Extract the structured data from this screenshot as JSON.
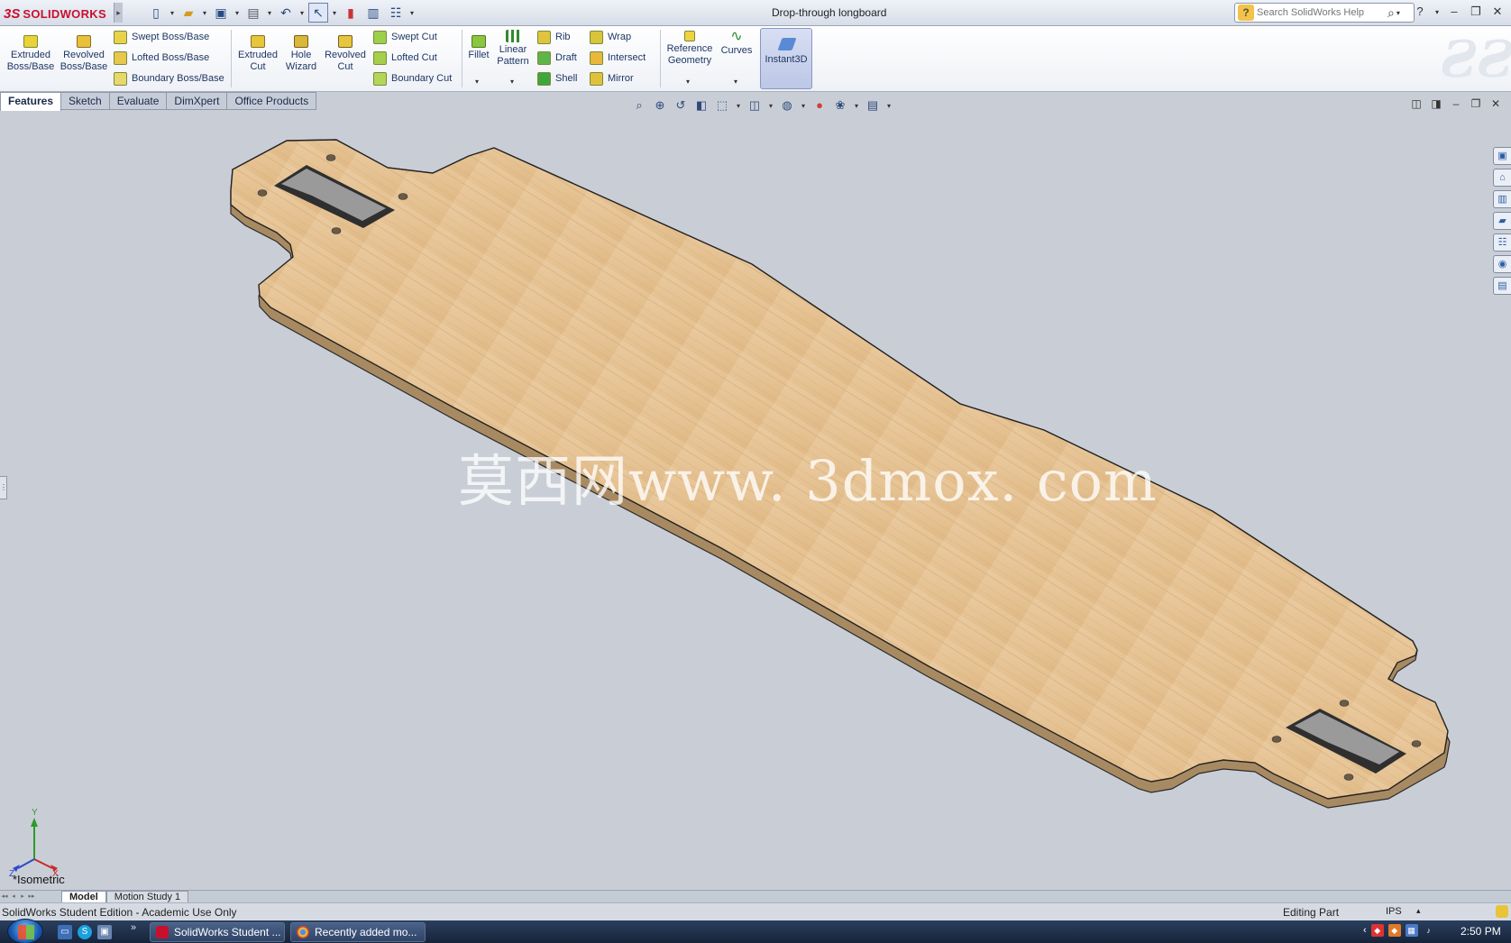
{
  "app": {
    "logo_ds": "3S",
    "logo_name": "SOLIDWORKS",
    "document_title": "Drop-through longboard",
    "search_placeholder": "Search SolidWorks Help",
    "help_label": "?"
  },
  "features_toolbar": {
    "big_buttons": [
      {
        "label": "Extruded Boss/Base",
        "icon": "extrude-boss-icon"
      },
      {
        "label": "Revolved Boss/Base",
        "icon": "revolve-boss-icon"
      },
      {
        "label": "Extruded Cut",
        "icon": "extrude-cut-icon"
      },
      {
        "label": "Hole Wizard",
        "icon": "hole-wizard-icon"
      },
      {
        "label": "Revolved Cut",
        "icon": "revolve-cut-icon"
      },
      {
        "label": "Fillet",
        "icon": "fillet-icon"
      },
      {
        "label": "Linear Pattern",
        "icon": "linear-pattern-icon"
      },
      {
        "label": "Reference Geometry",
        "icon": "reference-geometry-icon"
      },
      {
        "label": "Curves",
        "icon": "curves-icon"
      },
      {
        "label": "Instant3D",
        "icon": "instant3d-icon"
      }
    ],
    "small_buttons": [
      {
        "label": "Swept Boss/Base"
      },
      {
        "label": "Lofted Boss/Base"
      },
      {
        "label": "Boundary Boss/Base"
      },
      {
        "label": "Swept Cut"
      },
      {
        "label": "Lofted Cut"
      },
      {
        "label": "Boundary Cut"
      },
      {
        "label": "Rib"
      },
      {
        "label": "Draft"
      },
      {
        "label": "Shell"
      },
      {
        "label": "Wrap"
      },
      {
        "label": "Intersect"
      },
      {
        "label": "Mirror"
      }
    ]
  },
  "command_tabs": [
    "Features",
    "Sketch",
    "Evaluate",
    "DimXpert",
    "Office Products"
  ],
  "active_command_tab": "Features",
  "viewport": {
    "view_orientation": "*Isometric",
    "watermark": "莫西网www. 3dmox. com",
    "triad_labels": {
      "x": "X",
      "y": "Y",
      "z": "Z"
    },
    "model_color": "#e8c89a",
    "background_color": "#c9ced6"
  },
  "bottom_tabs": [
    "Model",
    "Motion Study 1"
  ],
  "status_bar": {
    "edition": "SolidWorks Student Edition - Academic Use Only",
    "mode": "Editing Part",
    "units": "IPS"
  },
  "taskbar": {
    "items": [
      {
        "label": "SolidWorks Student ...",
        "icon": "solidworks-icon"
      },
      {
        "label": "Recently added mo...",
        "icon": "chrome-icon"
      }
    ],
    "clock": "2:50 PM"
  }
}
